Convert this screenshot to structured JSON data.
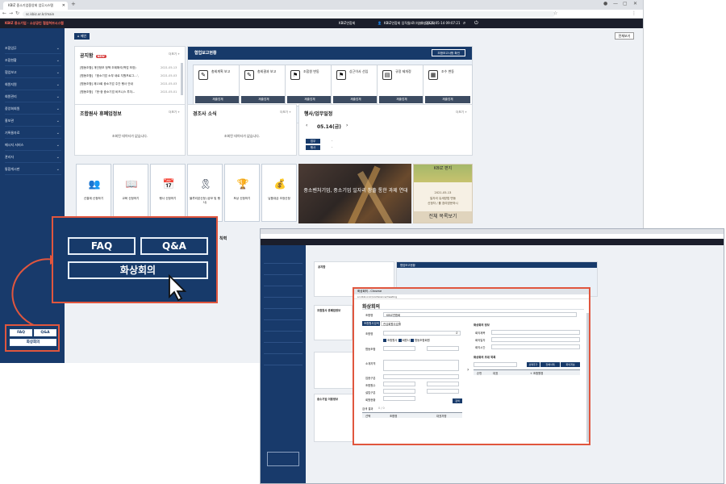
{
  "main_browser": {
    "tab_title": "KBIZ 중소기업중앙회 업무시스템",
    "url": "sc.kbiz.or.kr/main",
    "topbar": {
      "brand": "KBIZ 중소기업 · 소상공인 협업허브시스템",
      "org": "KBIZ연합회",
      "user": "KBIZ연합회 임직원 로그인하셨습니다",
      "last_login_label": "Last Login",
      "last_login": "2021-05-14 09:07:21"
    },
    "sidebar_items": [
      "조합업무",
      "조합현황",
      "협업보고",
      "회원지원",
      "회원관리",
      "중앙회회원",
      "홍보관",
      "기록물자료",
      "메시지 서비스",
      "관리자",
      "통합게시판"
    ],
    "breadcrumb": "메인",
    "wide_view": "전체보기",
    "notice": {
      "title": "공지함",
      "badge": "NEW",
      "more": "더보기 +",
      "rows": [
        {
          "text": "[협동조합] 개인정보 정책 조례해석(백업 보장)",
          "date": "2021-05-13"
        },
        {
          "text": "[협동조합] 『중소기업 소부 새로 지원프로그...', ",
          "date": "2021-05-03"
        },
        {
          "text": "[협동조합] 제15회 중소기업 주간 행사 안내",
          "date": "2021-05-03"
        },
        {
          "text": "[협동조합] 『한·중 중소기업 비즈니스 투자...",
          "date": "2021-05-01"
        }
      ]
    },
    "report": {
      "title": "협업보고현황",
      "action": "조합보고사항 확인",
      "cards": [
        {
          "label": "총회계획 보고",
          "icon": "✎",
          "foot": "제출업체"
        },
        {
          "label": "총회결과 보고",
          "icon": "✎",
          "foot": "제출업체"
        },
        {
          "label": "조합원 변동",
          "icon": "⚑",
          "foot": "제출업체"
        },
        {
          "label": "상근이사 선임",
          "icon": "⚑",
          "foot": "제출업체"
        },
        {
          "label": "규정 제개정",
          "icon": "▤",
          "foot": "제출업체"
        },
        {
          "label": "조수 변동",
          "icon": "▦",
          "foot": "제출업체"
        }
      ]
    },
    "lower_panels": [
      {
        "title": "조합원사 휴폐업정보",
        "more": "더보기 +",
        "empty": "조회된 데이터가 없습니다."
      },
      {
        "title": "경조사 소식",
        "more": "더보기 +",
        "empty": "조회된 데이터가 없습니다."
      }
    ],
    "schedule": {
      "title": "행사/업무일정",
      "more": "더보기 +",
      "date": "05.14(금)",
      "rows": [
        {
          "tag": "업무",
          "value": "-"
        },
        {
          "tag": "행사",
          "value": "-"
        }
      ]
    },
    "quick_links": [
      {
        "label": "선결제 신청하기",
        "icon": "👥"
      },
      {
        "label": "교육 신청하기",
        "icon": "📖"
      },
      {
        "label": "행사 신청하기",
        "icon": "📅"
      },
      {
        "label": "블루리본신청 (공모 및 행사)",
        "icon": "🎗"
      },
      {
        "label": "포상 신청하기",
        "icon": "🏆"
      },
      {
        "label": "납품대금 조정신청",
        "icon": "💰"
      }
    ],
    "banner_text": "중소벤처기업, 중소기업 일자리 창출 통한 과제 연대",
    "webzine": {
      "title": "KBIZ 편지",
      "date": "2021-05-13",
      "line1": "일자리 유세방법 변동",
      "line2": "신청자 / 를 참여방문하시",
      "more": "전체 목록보기"
    }
  },
  "callout": {
    "faq": "FAQ",
    "qna": "Q&A",
    "video_meeting": "화상회의",
    "next_panel_title": "칙력"
  },
  "mini_buttons": {
    "faq": "FAQ",
    "qna": "Q&A",
    "video_meeting": "화상회의"
  },
  "second_window": {
    "notice_title": "공지함",
    "report_title": "협업보고현황",
    "lower_title": "조합원사 휴폐업정보",
    "bottom_title": "중소기업 이용정보"
  },
  "popup": {
    "window_title": "화상회의 - Chrome",
    "url": "sc.kbiz.or.kr/conference/meeting",
    "heading": "화상회의",
    "org_label": "조합명",
    "org_value": "KBIZ연합회",
    "tab_active": "조합원사검색",
    "tab_other": "관심회원사검색",
    "search_label": "조합명",
    "check_a": "조합원사",
    "check_b": "회원사",
    "check_c": "협동조합회원",
    "fields": [
      "협동조합",
      "소재지역",
      "업종구분",
      "조합원수",
      "설립구분",
      "회원현황"
    ],
    "search_btn": "검색",
    "result_label": "검색 결과",
    "result_count": "0 / 0",
    "col_a": "선택",
    "col_b": "조합명",
    "col_c": "대표자명",
    "right_title": "화상회의 정보",
    "meeting_title_label": "회의제목",
    "date_label": "회의일자",
    "time_label": "회의시간",
    "attendee_title": "화상회의 초대 목록",
    "btn_1": "선택추가",
    "btn_2": "전체삭제",
    "btn_3": "회의개설",
    "send_btn": "초대전송",
    "att_col_a": "순번",
    "att_col_b": "대표",
    "att_col_c": "+ 조합원명"
  }
}
